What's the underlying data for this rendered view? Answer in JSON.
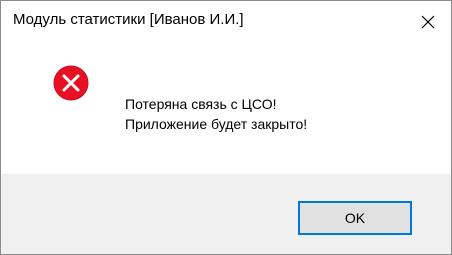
{
  "window": {
    "title": "Модуль статистики [Иванов И.И.]",
    "close_icon": "close-icon"
  },
  "message": {
    "icon": "error-icon",
    "line1": "Потеряна связь с ЦСО!",
    "line2": "Приложение будет закрыто!"
  },
  "buttons": {
    "ok_label": "OK"
  },
  "colors": {
    "error_red": "#e81123",
    "accent_blue": "#0078d7",
    "footer_bg": "#f0f0f0",
    "button_bg": "#e1e1e1"
  }
}
